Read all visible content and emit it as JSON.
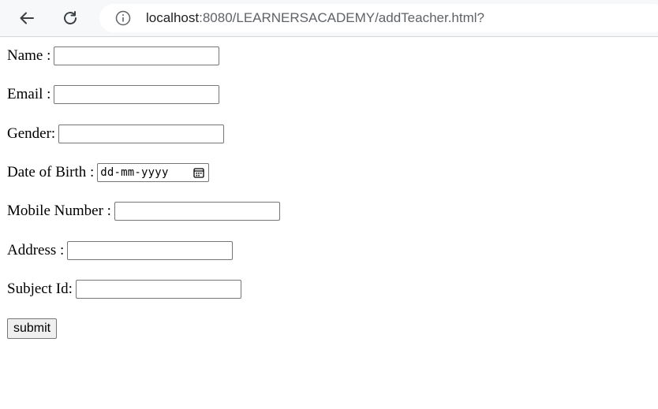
{
  "browser": {
    "url_host": "localhost",
    "url_rest": ":8080/LEARNERSACADEMY/addTeacher.html?",
    "icons": {
      "back": "arrow-left-icon",
      "reload": "reload-icon",
      "info": "info-icon"
    }
  },
  "form": {
    "name_label": "Name :",
    "email_label": "Email :",
    "gender_label": "Gender:",
    "dob_label": "Date of Birth :",
    "dob_placeholder": "dd-mm-yyyy",
    "mobile_label": "Mobile Number :",
    "address_label": "Address :",
    "subject_label": "Subject Id:",
    "submit_label": "submit"
  },
  "colors": {
    "toolbar_bg": "#f7f8fa",
    "input_border": "#767676",
    "button_bg": "#efefef"
  }
}
